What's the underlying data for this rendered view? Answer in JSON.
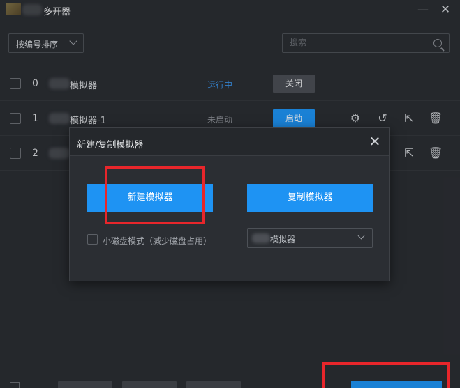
{
  "window": {
    "title": "多开器",
    "minimize_icon": "minimize-icon",
    "close_icon": "close-icon"
  },
  "toolbar": {
    "sort_label": "按编号排序",
    "search_placeholder": "搜索"
  },
  "rows": [
    {
      "index": "0",
      "name": "模拟器",
      "status": "运行中",
      "action": "关闭"
    },
    {
      "index": "1",
      "name": "模拟器-1",
      "status": "未启动",
      "action": "启动"
    },
    {
      "index": "2",
      "name": ""
    }
  ],
  "dialog": {
    "title": "新建/复制模拟器",
    "new_button": "新建模拟器",
    "copy_button": "复制模拟器",
    "small_disk_label": "小磁盘模式（减少磁盘占用）",
    "copy_source": "模拟器"
  },
  "colors": {
    "accent": "#1e93f3",
    "running": "#3b92e6",
    "highlight": "#e8262b",
    "background": "#2b2e33"
  }
}
